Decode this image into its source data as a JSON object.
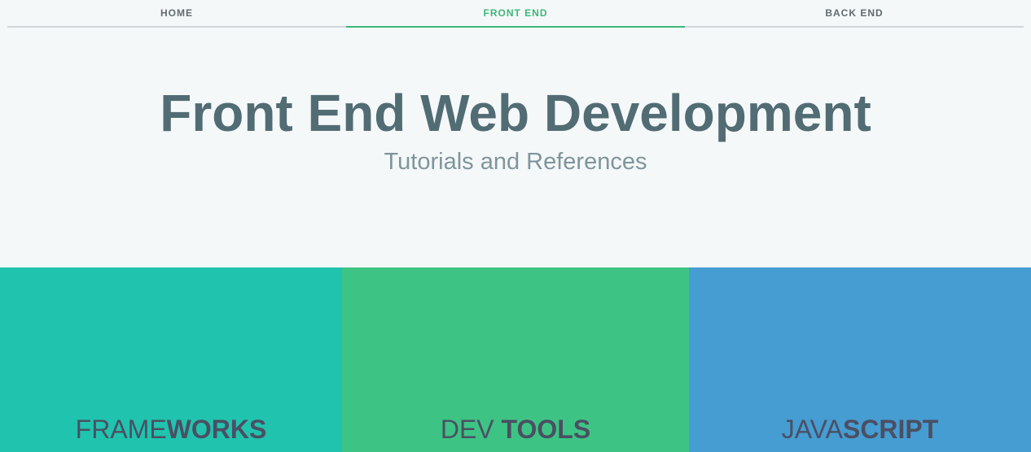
{
  "nav": {
    "items": [
      {
        "label": "HOME",
        "active": false
      },
      {
        "label": "FRONT END",
        "active": true
      },
      {
        "label": "BACK END",
        "active": false
      }
    ]
  },
  "hero": {
    "title": "Front End Web Development",
    "subtitle": "Tutorials and References"
  },
  "tiles": [
    {
      "light": "FRAME",
      "bold": "WORKS",
      "color": "#20c3ae"
    },
    {
      "light": "DEV",
      "bold": "TOOLS",
      "color": "#3dc484"
    },
    {
      "light": "JAVA",
      "bold": "SCRIPT",
      "color": "#459dd2"
    }
  ],
  "colors": {
    "accent": "#3cb878",
    "title": "#526c74",
    "subtitle": "#7f959c",
    "tile_text": "#4b4f63"
  }
}
